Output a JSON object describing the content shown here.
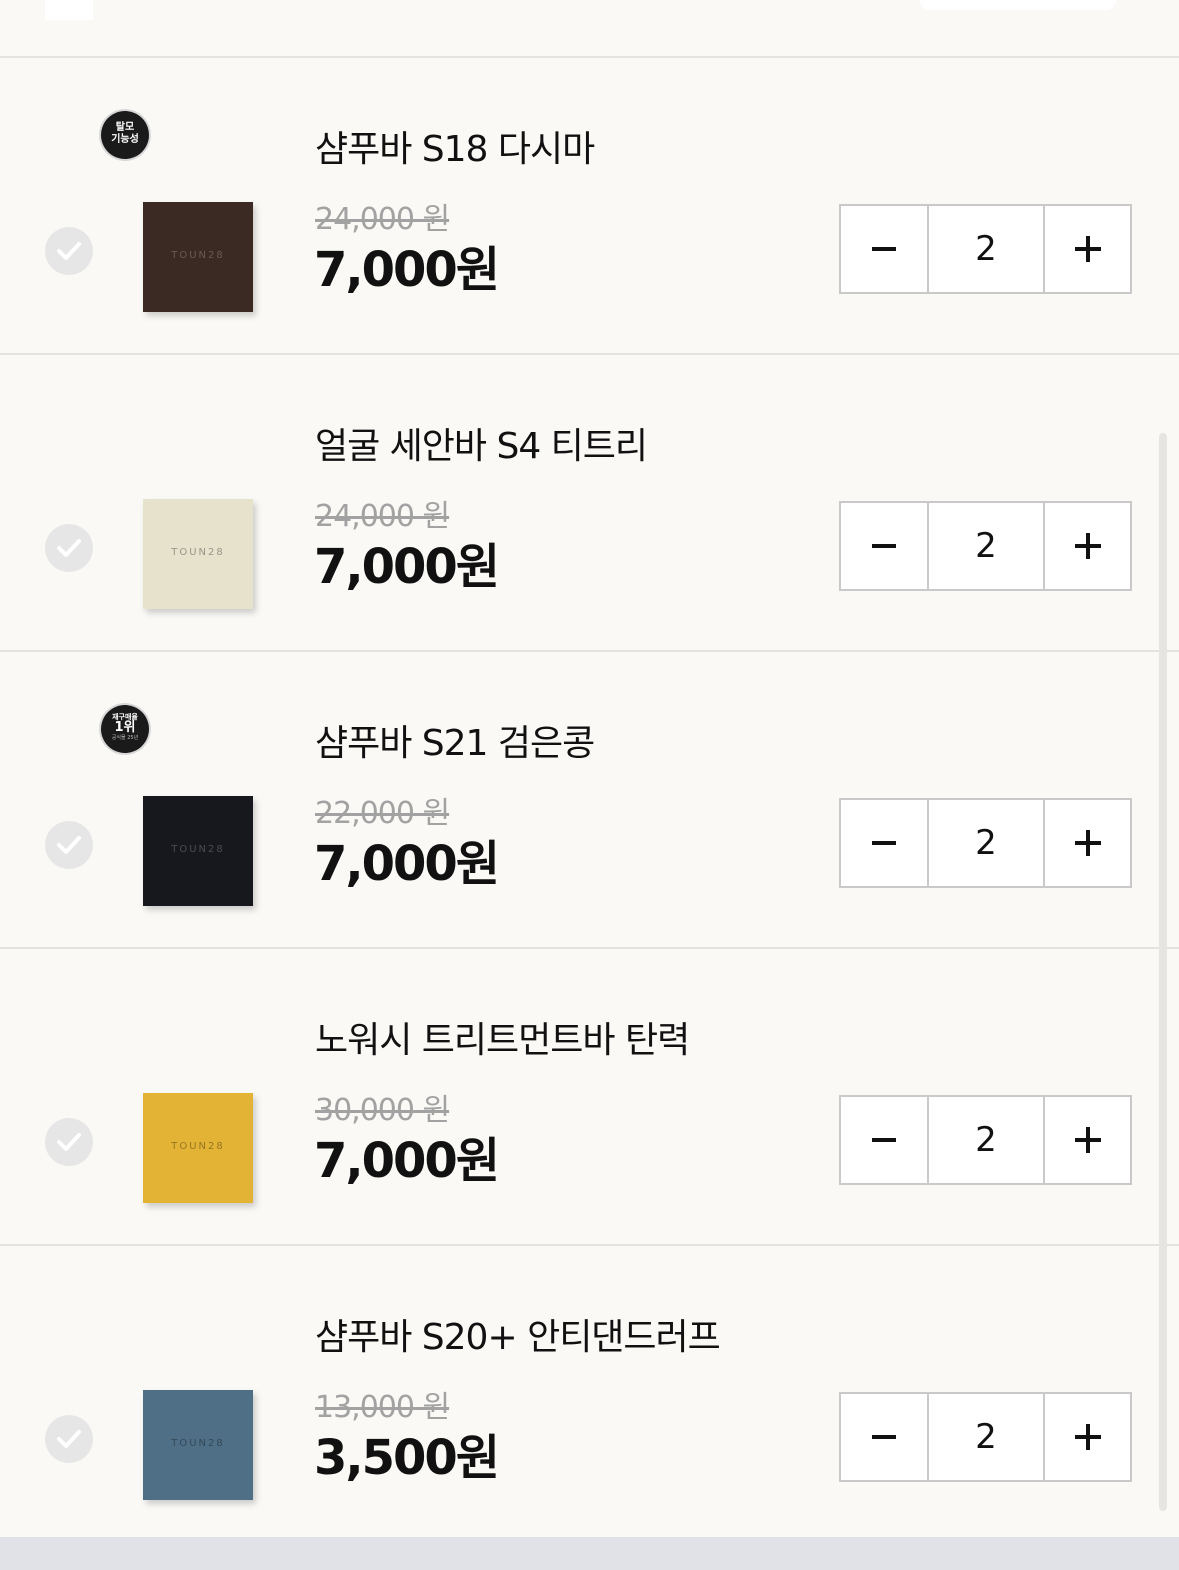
{
  "colors": {
    "background": "#faf9f6",
    "divider": "#e4e3e0",
    "strike_price": "#a2a2a2",
    "badge": "#1a1a1a",
    "bottom_bar": "#e1e1e8"
  },
  "items": [
    {
      "name": "샴푸바 S18 다시마",
      "original_price": "24,000 원",
      "price": "7,000원",
      "quantity": "2",
      "selected": false,
      "soap_color": "#3b2a23",
      "soap_logo": "TOUN28",
      "badge": {
        "line1": "탈모",
        "line2": "기능성"
      }
    },
    {
      "name": "얼굴 세안바 S4 티트리",
      "original_price": "24,000 원",
      "price": "7,000원",
      "quantity": "2",
      "selected": false,
      "soap_color": "#e6e2cc",
      "soap_logo": "TOUN28"
    },
    {
      "name": "샴푸바 S21 검은콩",
      "original_price": "22,000 원",
      "price": "7,000원",
      "quantity": "2",
      "selected": false,
      "soap_color": "#16181d",
      "soap_logo": "TOUN28",
      "badge": {
        "line1": "재구매율",
        "line2": "1위",
        "line3": "공식몰 25년"
      }
    },
    {
      "name": "노워시 트리트먼트바 탄력",
      "original_price": "30,000 원",
      "price": "7,000원",
      "quantity": "2",
      "selected": false,
      "soap_color": "#e3b335",
      "soap_logo": "TOUN28"
    },
    {
      "name": "샴푸바 S20+ 안티댄드러프",
      "original_price": "13,000 원",
      "price": "3,500원",
      "quantity": "2",
      "selected": false,
      "soap_color": "#4f6f86",
      "soap_logo": "TOUN28"
    }
  ],
  "icons": {
    "select": "checkmark-circle-icon",
    "decrease": "minus-icon",
    "increase": "plus-icon"
  }
}
